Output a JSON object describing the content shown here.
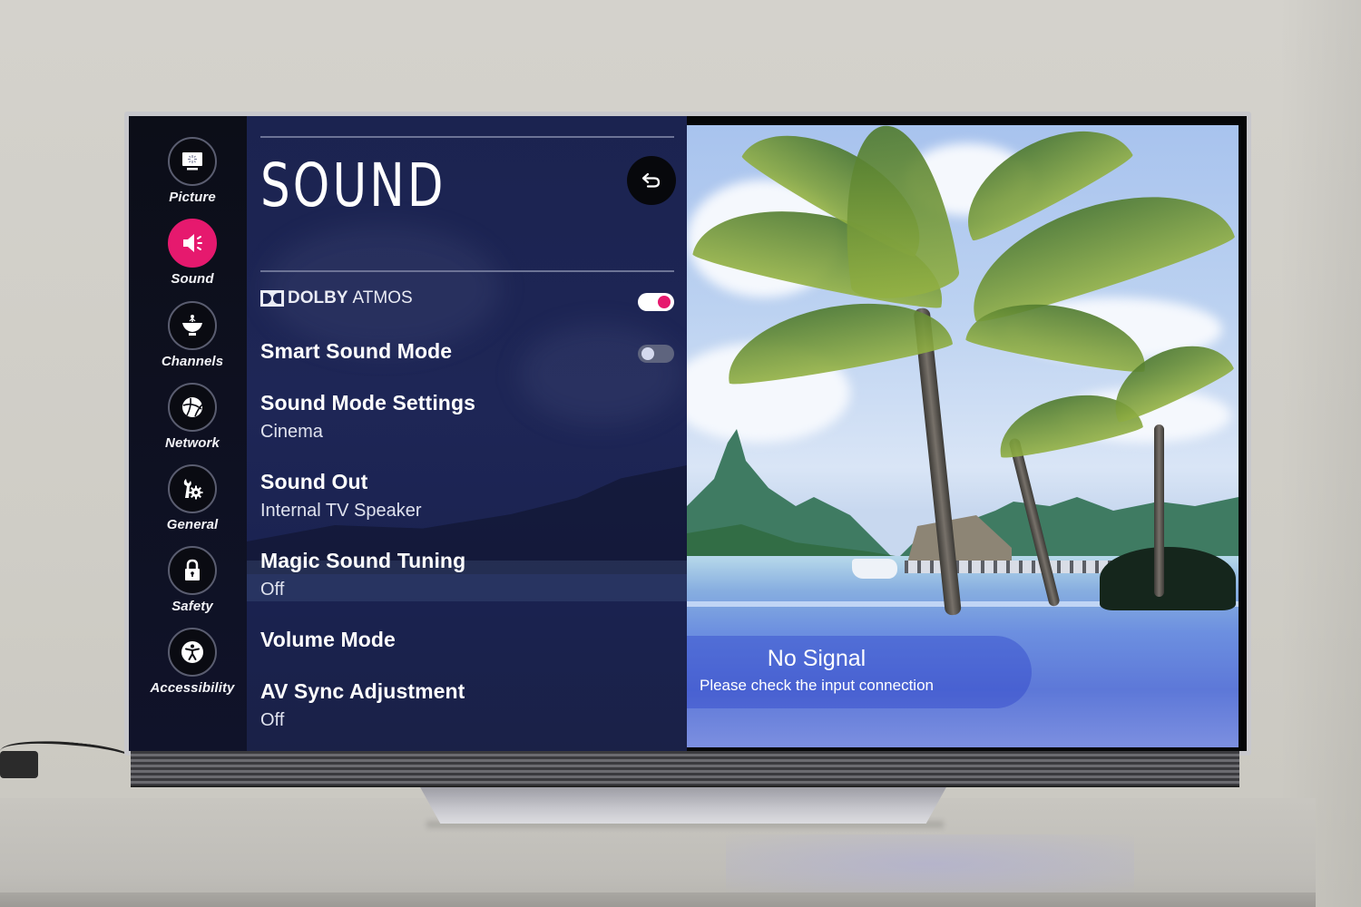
{
  "sidebar": {
    "items": [
      {
        "label": "Picture",
        "icon": "picture-icon",
        "active": false
      },
      {
        "label": "Sound",
        "icon": "speaker-icon",
        "active": true
      },
      {
        "label": "Channels",
        "icon": "satellite-dish-icon",
        "active": false
      },
      {
        "label": "Network",
        "icon": "globe-icon",
        "active": false
      },
      {
        "label": "General",
        "icon": "wrench-gear-icon",
        "active": false
      },
      {
        "label": "Safety",
        "icon": "lock-icon",
        "active": false
      },
      {
        "label": "Accessibility",
        "icon": "accessibility-icon",
        "active": false
      }
    ]
  },
  "panel": {
    "title": "SOUND",
    "back_icon": "back-arrow-icon",
    "dolby": {
      "brand": "DOLBY",
      "label": "ATMOS",
      "enabled": true
    },
    "settings": [
      {
        "title": "Smart Sound Mode",
        "toggle": false
      },
      {
        "title": "Sound Mode Settings",
        "value": "Cinema"
      },
      {
        "title": "Sound Out",
        "value": "Internal TV Speaker"
      },
      {
        "title": "Magic Sound Tuning",
        "value": "Off"
      },
      {
        "title": "Volume Mode"
      },
      {
        "title": "AV Sync Adjustment",
        "value": "Off"
      }
    ]
  },
  "signal": {
    "title": "No Signal",
    "message": "Please check the input connection"
  },
  "colors": {
    "accent": "#e6196e",
    "panel_bg": "#1d2553",
    "sidebar_bg": "#0c0e18"
  }
}
